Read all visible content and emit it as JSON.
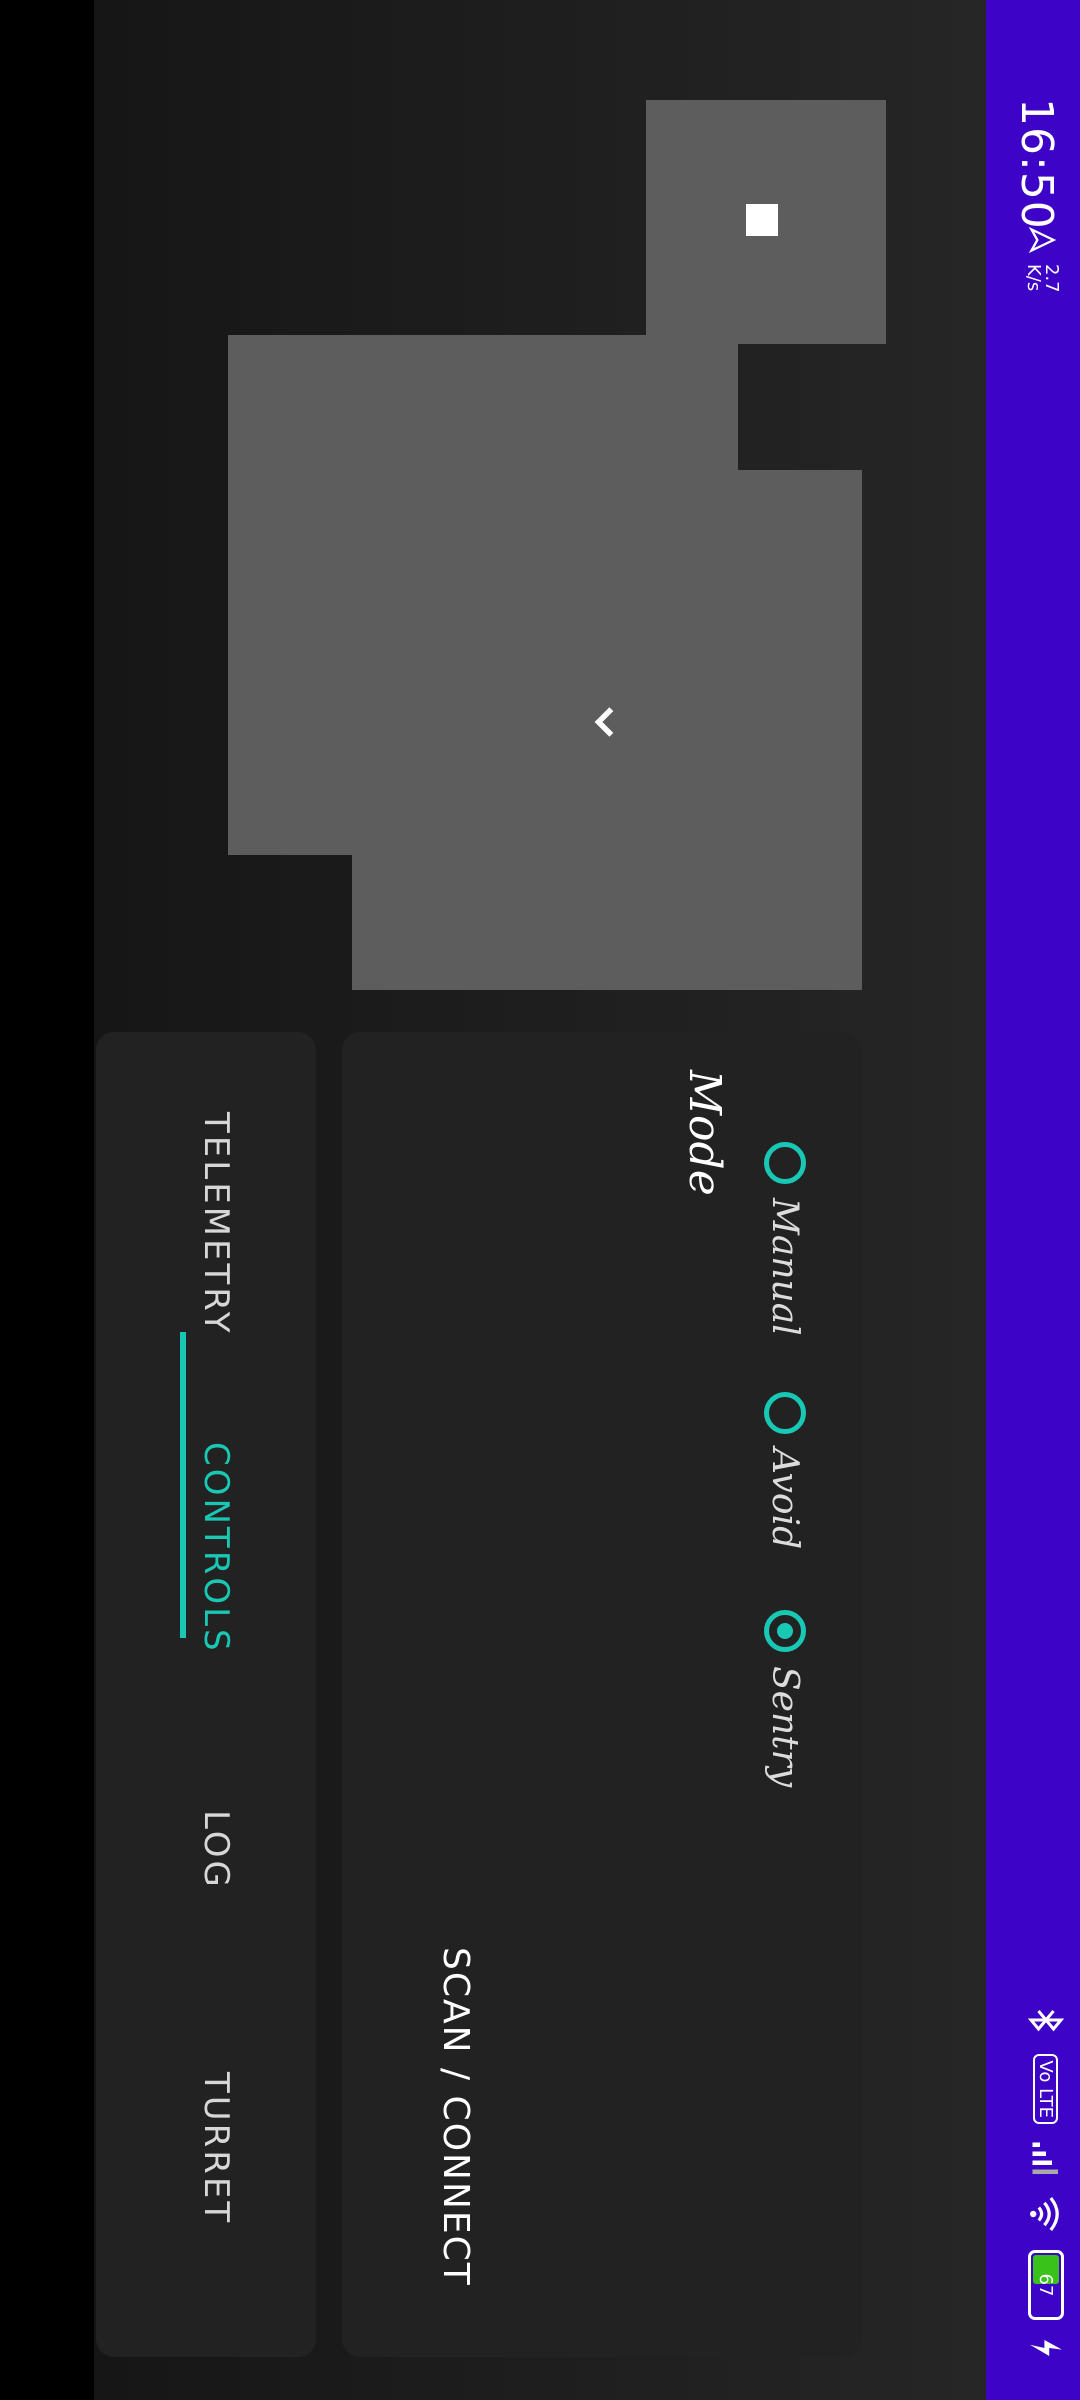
{
  "status_bar": {
    "time": "16:50",
    "data_speed": "2.7",
    "data_unit": "K/s",
    "volte_label": "Vo LTE",
    "battery_level": "67"
  },
  "mode": {
    "title": "Mode",
    "options": [
      "Manual",
      "Avoid",
      "Sentry"
    ],
    "selected": "Sentry"
  },
  "scan_connect_label": "SCAN / CONNECT",
  "tabs": [
    "TELEMETRY",
    "CONTROLS",
    "LOG",
    "TURRET"
  ],
  "active_tab": "CONTROLS",
  "colors": {
    "status_bar": "#3d03c6",
    "accent": "#19c8b4",
    "panel": "#222222",
    "control_square": "#5d5d5d"
  }
}
